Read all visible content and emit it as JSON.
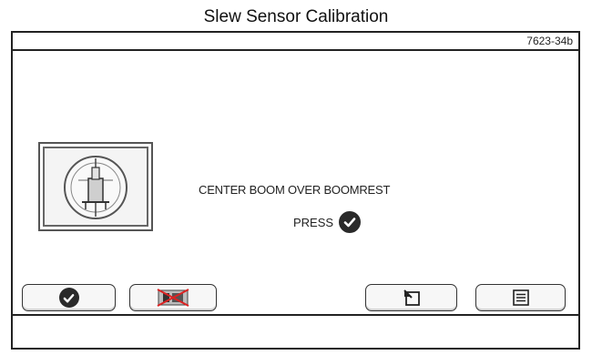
{
  "caption": "Slew Sensor Calibration",
  "figure_ref": "7623-34b",
  "screen": {
    "instruction": "CENTER BOOM OVER BOOMREST",
    "press_label": "PRESS"
  },
  "icons": {
    "instruction_image": "slew-boom-center-icon",
    "ok": "checkmark-icon",
    "disabled": "crossed-out-icon",
    "back": "return-arrow-icon",
    "menu": "menu-list-icon"
  },
  "colors": {
    "frame": "#222222",
    "dark_icon": "#2a2a2a",
    "button_bg": "#f7f7f7"
  }
}
